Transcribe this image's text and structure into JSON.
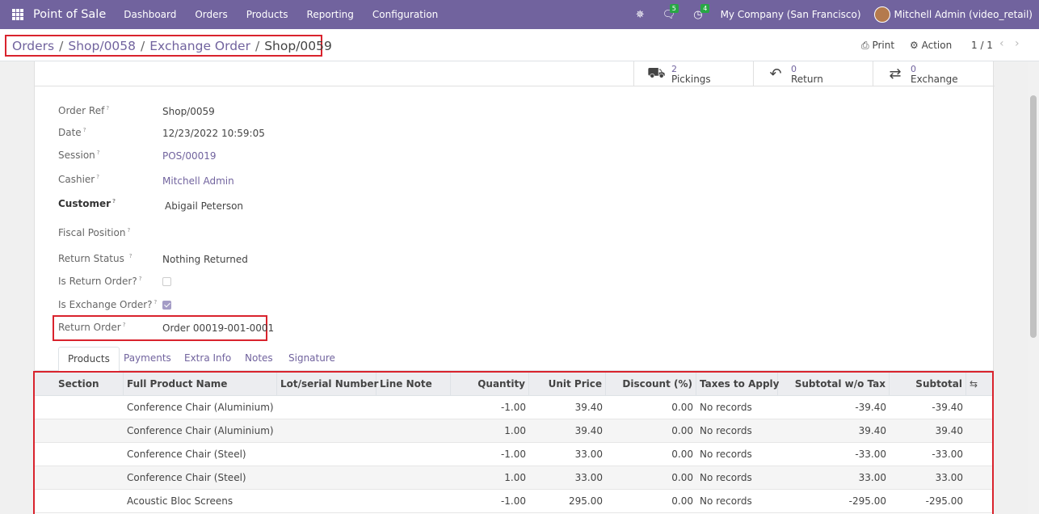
{
  "navbar": {
    "brand": "Point of Sale",
    "menu": [
      "Dashboard",
      "Orders",
      "Products",
      "Reporting",
      "Configuration"
    ],
    "messages_count": "5",
    "activities_count": "4",
    "company": "My Company (San Francisco)",
    "user": "Mitchell Admin (video_retail)"
  },
  "breadcrumb": {
    "items": [
      "Orders",
      "Shop/0058",
      "Exchange Order"
    ],
    "active": "Shop/0059"
  },
  "control": {
    "print": "Print",
    "action": "Action",
    "pager": "1 / 1"
  },
  "smart_buttons": [
    {
      "num": "2",
      "label": "Pickings"
    },
    {
      "num": "0",
      "label": "Return"
    },
    {
      "num": "0",
      "label": "Exchange"
    }
  ],
  "fields": {
    "order_ref": {
      "label": "Order Ref",
      "value": "Shop/0059"
    },
    "date": {
      "label": "Date",
      "value": "12/23/2022 10:59:05"
    },
    "session": {
      "label": "Session",
      "value": "POS/00019"
    },
    "cashier": {
      "label": "Cashier",
      "value": "Mitchell Admin"
    },
    "customer": {
      "label": "Customer",
      "value": "Abigail Peterson"
    },
    "fiscal_position": {
      "label": "Fiscal Position",
      "value": ""
    },
    "return_status": {
      "label": "Return Status",
      "value": "Nothing Returned"
    },
    "is_return_order": {
      "label": "Is Return Order?",
      "checked": false
    },
    "is_exchange_order": {
      "label": "Is Exchange Order?",
      "checked": true
    },
    "return_order": {
      "label": "Return Order",
      "value": "Order 00019-001-0001"
    }
  },
  "tabs": [
    "Products",
    "Payments",
    "Extra Info",
    "Notes",
    "Signature"
  ],
  "table": {
    "headers": [
      "Section",
      "Full Product Name",
      "Lot/serial Number",
      "Line Note",
      "Quantity",
      "Unit Price",
      "Discount (%)",
      "Taxes to Apply",
      "Subtotal w/o Tax",
      "Subtotal"
    ],
    "rows": [
      {
        "name": "Conference Chair (Aluminium)",
        "qty": "-1.00",
        "price": "39.40",
        "disc": "0.00",
        "taxes": "No records",
        "subtotal_wo": "-39.40",
        "subtotal": "-39.40"
      },
      {
        "name": "Conference Chair (Aluminium)",
        "qty": "1.00",
        "price": "39.40",
        "disc": "0.00",
        "taxes": "No records",
        "subtotal_wo": "39.40",
        "subtotal": "39.40"
      },
      {
        "name": "Conference Chair (Steel)",
        "qty": "-1.00",
        "price": "33.00",
        "disc": "0.00",
        "taxes": "No records",
        "subtotal_wo": "-33.00",
        "subtotal": "-33.00"
      },
      {
        "name": "Conference Chair (Steel)",
        "qty": "1.00",
        "price": "33.00",
        "disc": "0.00",
        "taxes": "No records",
        "subtotal_wo": "33.00",
        "subtotal": "33.00"
      },
      {
        "name": "Acoustic Bloc Screens",
        "qty": "-1.00",
        "price": "295.00",
        "disc": "0.00",
        "taxes": "No records",
        "subtotal_wo": "-295.00",
        "subtotal": "-295.00"
      }
    ]
  },
  "colors": {
    "brand": "#71639e",
    "highlight": "#d9232d",
    "badge": "#28a745"
  }
}
